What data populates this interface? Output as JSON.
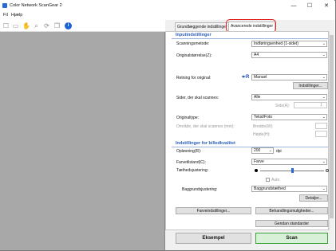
{
  "window": {
    "title": "Color Network ScanGear 2"
  },
  "controls": {
    "minimize": "—",
    "maximize": "☐",
    "close": "✕"
  },
  "menu": {
    "file": "Fil",
    "help": "Hjælp"
  },
  "tabs": {
    "basic": "Grundlæggende indstillinger",
    "advanced": "Avancerede indstillinger"
  },
  "input": {
    "heading": "Inputindstillinger",
    "scan_mode_label": "Scanningsmetode:",
    "scan_mode_value": "Indføringsenhed (1-sidet)",
    "doc_size_label": "Originalstørrelse(Z):",
    "doc_size_value": "A4",
    "orientation_label": "Retning for original:",
    "orientation_value": "Manuel",
    "settings_button": "Indstillinger...",
    "pages_label": "Sider, der skal scannes:",
    "pages_value": "Alle",
    "page_field_label": "Side(A):",
    "page_value": "1",
    "doc_type_label": "Originaltype:",
    "doc_type_value": "Tekst/Foto",
    "area_label": "Område, der skal scannes (mm):",
    "width_label": "Bredde(W):",
    "height_label": "Højde(H):"
  },
  "quality": {
    "heading": "Indstillinger for billedkvalitet",
    "resolution_label": "Opløsning(R):",
    "resolution_value": "200",
    "resolution_unit": "dpi",
    "color_mode_label": "Farvetilstand(C):",
    "color_mode_value": "Farve",
    "density_label": "Tæthedsjustering:",
    "density_level": 0.5,
    "auto_label": "Auto",
    "background_label": "Baggrundsjustering:",
    "background_value": "Baggrundstæthed",
    "details_button": "Detaljer...",
    "color_settings_button": "Farveindstillinger...",
    "processing_button": "Behandlingsmuligheder...",
    "restore_button": "Gendan standarder"
  },
  "actions": {
    "preview": "Eksempel",
    "scan": "Scan"
  }
}
